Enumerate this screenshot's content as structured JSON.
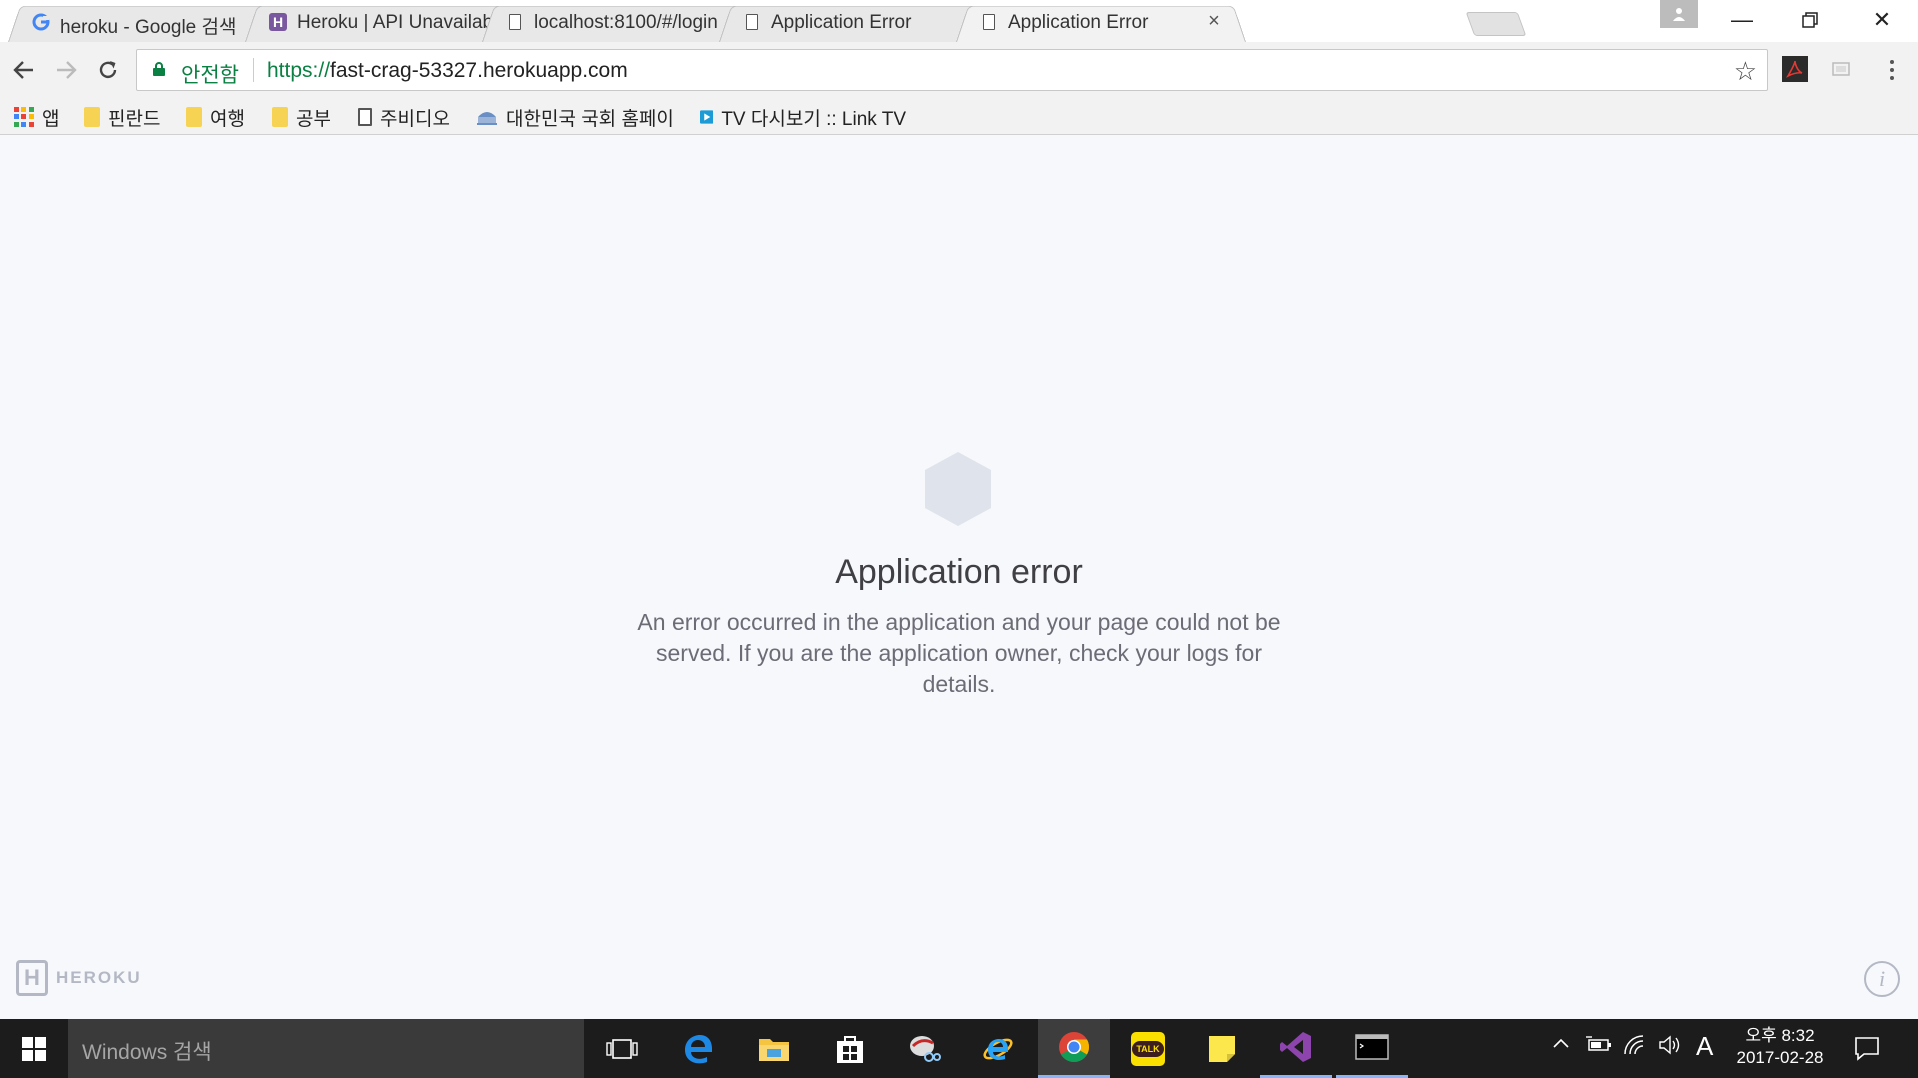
{
  "browser": {
    "tabs": [
      {
        "title": "heroku - Google 검색",
        "favicon": "google-icon",
        "active": false
      },
      {
        "title": "Heroku | API Unavailable",
        "favicon": "heroku-icon",
        "active": false
      },
      {
        "title": "localhost:8100/#/login",
        "favicon": "page-icon",
        "active": false
      },
      {
        "title": "Application Error",
        "favicon": "page-icon",
        "active": false
      },
      {
        "title": "Application Error",
        "favicon": "page-icon",
        "active": true
      }
    ],
    "address_bar": {
      "security_label": "안전함",
      "url_scheme": "https://",
      "url_host": "fast-crag-53327.herokuapp.com"
    },
    "bookmarks": [
      {
        "label": "앱",
        "icon": "apps-grid-icon"
      },
      {
        "label": "핀란드",
        "icon": "folder-icon"
      },
      {
        "label": "여행",
        "icon": "folder-icon"
      },
      {
        "label": "공부",
        "icon": "folder-icon"
      },
      {
        "label": "주비디오",
        "icon": "page-icon"
      },
      {
        "label": "대한민국 국회 홈페이",
        "icon": "assembly-icon"
      },
      {
        "label": "TV 다시보기 :: Link TV",
        "icon": "tv-play-icon"
      }
    ]
  },
  "page": {
    "title": "Application error",
    "message": "An error occurred in the application and your page could not be served. If you are the application owner, check your logs for details.",
    "logo_text": "HEROKU",
    "logo_letter": "H",
    "info_symbol": "i"
  },
  "taskbar": {
    "search_placeholder": "Windows 검색",
    "ime_indicator": "A",
    "clock_time": "오후 8:32",
    "clock_date": "2017-02-28",
    "talk_label": "TALK"
  },
  "colors": {
    "page_background": "#f7f8fb",
    "hexagon": "#dfe3ec",
    "secure_green": "#0b8043",
    "taskbar": "#1c1c1c"
  }
}
